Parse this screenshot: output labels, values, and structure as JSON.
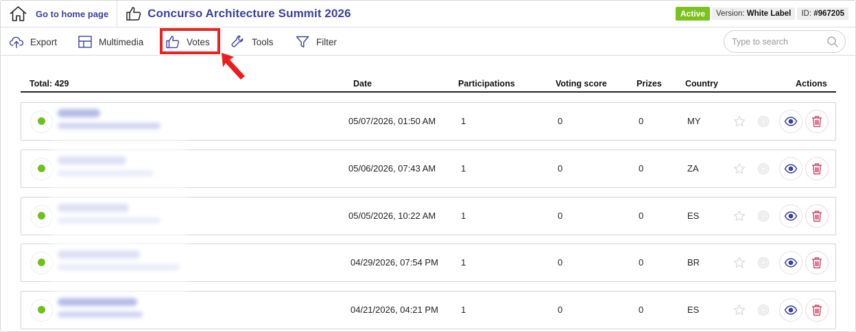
{
  "header": {
    "home_label": "Go to home page",
    "contest_title": "Concurso Architecture Summit 2026",
    "status": "Active",
    "version_prefix": "Version:",
    "version_value": "White Label",
    "id_prefix": "ID:",
    "id_value": "#967205"
  },
  "toolbar": {
    "export_label": "Export",
    "multimedia_label": "Multimedia",
    "votes_label": "Votes",
    "tools_label": "Tools",
    "filter_label": "Filter",
    "search_placeholder": "Type to search",
    "highlight_color": "#ee2020"
  },
  "table": {
    "total_label": "Total: 429",
    "columns": {
      "date": "Date",
      "participations": "Participations",
      "voting_score": "Voting score",
      "prizes": "Prizes",
      "country": "Country",
      "actions": "Actions"
    },
    "rows": [
      {
        "date": "05/07/2026, 01:50 AM",
        "participations": "1",
        "voting_score": "0",
        "prizes": "0",
        "country": "MY"
      },
      {
        "date": "05/06/2026, 07:43 AM",
        "participations": "1",
        "voting_score": "0",
        "prizes": "0",
        "country": "ZA"
      },
      {
        "date": "05/05/2026, 10:22 AM",
        "participations": "1",
        "voting_score": "0",
        "prizes": "0",
        "country": "ES"
      },
      {
        "date": "04/29/2026, 07:54 PM",
        "participations": "1",
        "voting_score": "0",
        "prizes": "0",
        "country": "BR"
      },
      {
        "date": "04/21/2026, 04:21 PM",
        "participations": "1",
        "voting_score": "0",
        "prizes": "0",
        "country": "ES"
      }
    ]
  },
  "colors": {
    "brand": "#3b3fa0",
    "active": "#7ac21e",
    "status_dot": "#6fbf1d",
    "delete": "#d2456a"
  }
}
